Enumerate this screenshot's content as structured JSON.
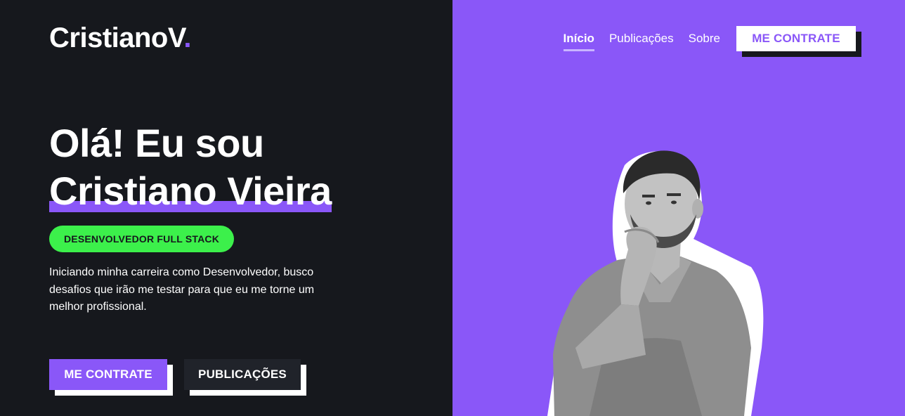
{
  "brand": {
    "name": "CristianoV",
    "dot": "."
  },
  "nav": {
    "items": [
      {
        "label": "Início",
        "active": true
      },
      {
        "label": "Publicações",
        "active": false
      },
      {
        "label": "Sobre",
        "active": false
      }
    ],
    "hire_label": "ME CONTRATE"
  },
  "hero": {
    "greeting": "Olá! Eu sou",
    "name": "Cristiano Vieira",
    "role_badge": "DESENVOLVEDOR FULL STACK",
    "intro": "Iniciando minha carreira como Desenvolvedor, busco desafios que irão me testar para que eu me torne um melhor profissional.",
    "cta_primary": "ME CONTRATE",
    "cta_secondary": "PUBLICAÇÕES"
  },
  "colors": {
    "accent": "#8a57f8",
    "dark_bg": "#16181d",
    "badge_green": "#3cf04b",
    "white": "#ffffff"
  },
  "portrait": {
    "icon": "person-portrait"
  }
}
